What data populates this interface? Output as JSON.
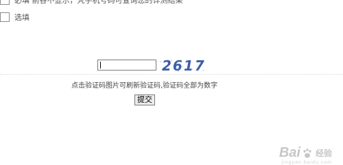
{
  "options": {
    "required_label": "必填 前各不显示，凭手机号码可查询您的详测结果",
    "optional_label": "选填"
  },
  "captcha": {
    "input_value": "",
    "image_text": "2617",
    "hint": "点击验证码图片可刷新验证码,验证码全部为数字"
  },
  "form": {
    "submit_label": "提交"
  },
  "watermark": {
    "brand_left": "Bai",
    "brand_right": "经验",
    "sub": "jingyan.baidu.com"
  }
}
